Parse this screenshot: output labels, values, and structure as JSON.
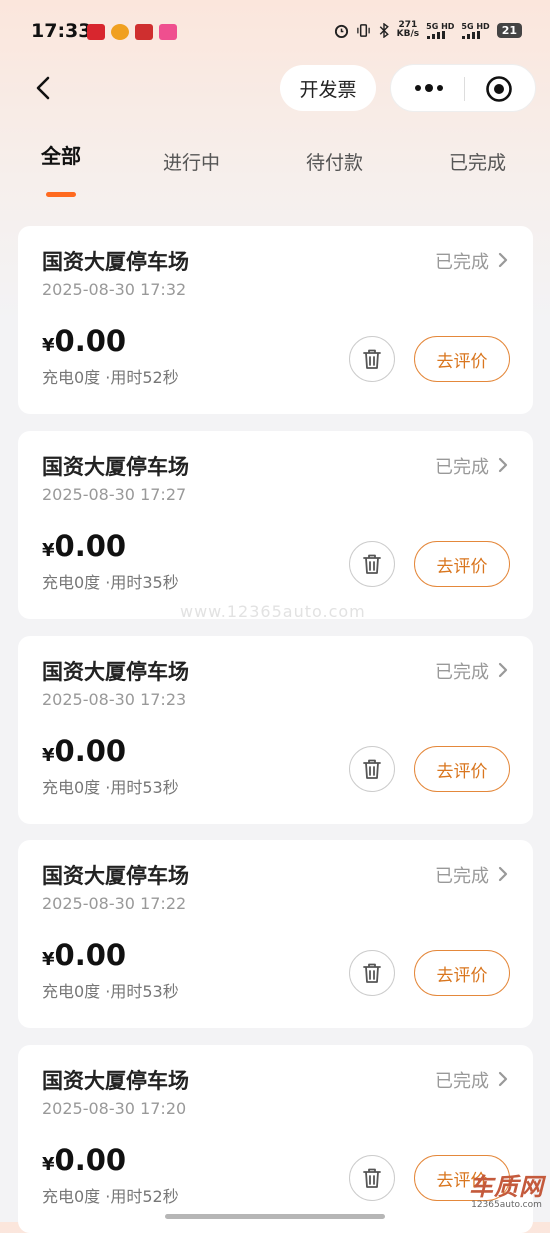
{
  "status_bar": {
    "time": "17:33",
    "net_speed_value": "271",
    "net_speed_unit": "KB/s",
    "signal_1": "5G HD",
    "signal_2": "5G HD",
    "battery": "21"
  },
  "header": {
    "invoice_label": "开发票"
  },
  "tabs": [
    {
      "label": "全部",
      "active": true
    },
    {
      "label": "进行中",
      "active": false
    },
    {
      "label": "待付款",
      "active": false
    },
    {
      "label": "已完成",
      "active": false
    }
  ],
  "orders": [
    {
      "title": "国资大厦停车场",
      "status": "已完成",
      "time": "2025-08-30 17:32",
      "currency": "¥",
      "amount": "0.00",
      "detail": "充电0度 ·用时52秒",
      "review_label": "去评价"
    },
    {
      "title": "国资大厦停车场",
      "status": "已完成",
      "time": "2025-08-30 17:27",
      "currency": "¥",
      "amount": "0.00",
      "detail": "充电0度 ·用时35秒",
      "review_label": "去评价"
    },
    {
      "title": "国资大厦停车场",
      "status": "已完成",
      "time": "2025-08-30 17:23",
      "currency": "¥",
      "amount": "0.00",
      "detail": "充电0度 ·用时53秒",
      "review_label": "去评价"
    },
    {
      "title": "国资大厦停车场",
      "status": "已完成",
      "time": "2025-08-30 17:22",
      "currency": "¥",
      "amount": "0.00",
      "detail": "充电0度 ·用时53秒",
      "review_label": "去评价"
    },
    {
      "title": "国资大厦停车场",
      "status": "已完成",
      "time": "2025-08-30 17:20",
      "currency": "¥",
      "amount": "0.00",
      "detail": "充电0度 ·用时52秒",
      "review_label": "去评价"
    }
  ],
  "watermark": {
    "middle": "www.12365auto.com",
    "logo": "车质网",
    "url": "12365auto.com"
  },
  "colors": {
    "accent": "#ff6a1f",
    "review_border": "#e4883b",
    "review_text": "#d9761f"
  }
}
